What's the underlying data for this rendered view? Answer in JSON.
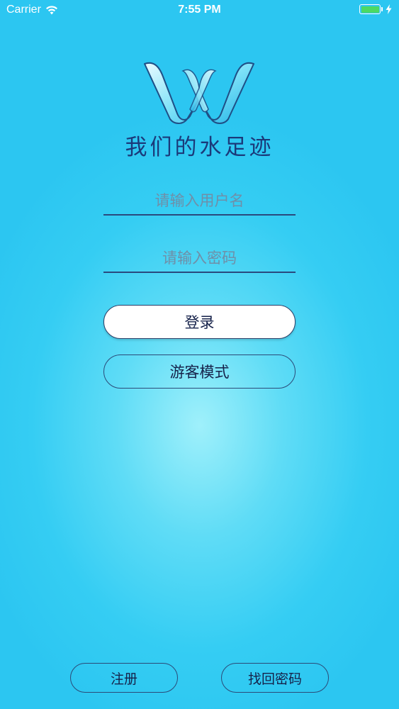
{
  "status_bar": {
    "carrier": "Carrier",
    "time": "7:55 PM",
    "wifi_icon": "wifi-icon",
    "battery_icon": "battery-icon",
    "charging_icon": "bolt-icon",
    "battery_color": "#4cd964"
  },
  "brand": {
    "logo_icon": "w-logo-icon",
    "title": "我们的水足迹"
  },
  "form": {
    "username_placeholder": "请输入用户名",
    "username_value": "",
    "password_placeholder": "请输入密码",
    "password_value": ""
  },
  "actions": {
    "login_label": "登录",
    "guest_label": "游客模式",
    "register_label": "注册",
    "recover_label": "找回密码"
  },
  "colors": {
    "background": "#35cdf3",
    "title_text": "#1b3a7a",
    "button_text": "#16224a"
  }
}
